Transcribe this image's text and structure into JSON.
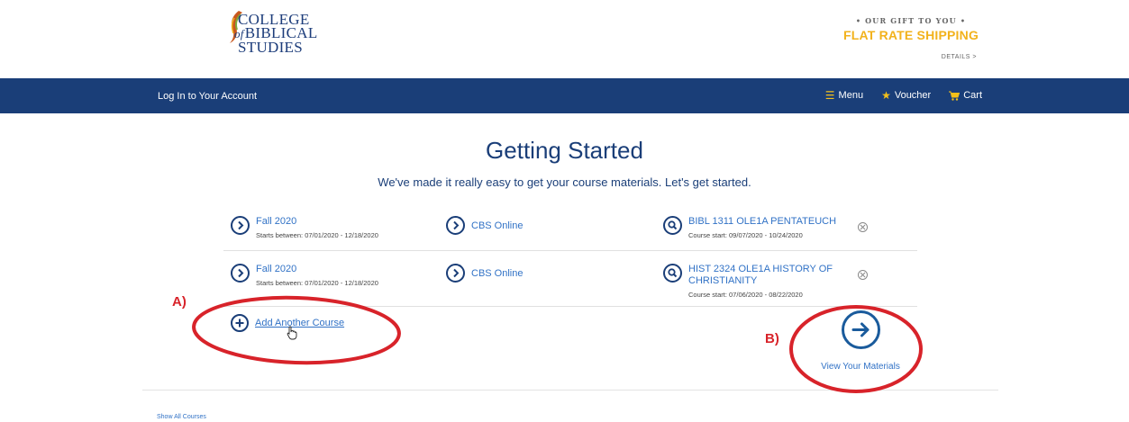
{
  "logo": {
    "line1": "COLLEGE",
    "line2_prefix": "of",
    "line2": "BIBLICAL",
    "line3": "STUDIES"
  },
  "promo": {
    "top": "• OUR GIFT TO YOU •",
    "main": "FLAT RATE SHIPPING",
    "details": "DETAILS >"
  },
  "navbar": {
    "login": "Log In to Your Account",
    "menu": "Menu",
    "voucher": "Voucher",
    "cart": "Cart",
    "color": "#1a3e78"
  },
  "main": {
    "title": "Getting Started",
    "subtitle": "We've made it really easy to get your course materials. Let's get started."
  },
  "courses": [
    {
      "term": "Fall 2020",
      "term_dates": "Starts between: 07/01/2020 - 12/18/2020",
      "school": "CBS Online",
      "course": "BIBL 1311 OLE1A PENTATEUCH",
      "course_dates": "Course start: 09/07/2020 - 10/24/2020"
    },
    {
      "term": "Fall 2020",
      "term_dates": "Starts between: 07/01/2020 - 12/18/2020",
      "school": "CBS Online",
      "course": "HIST 2324 OLE1A HISTORY OF CHRISTIANITY",
      "course_dates": "Course start: 07/06/2020 - 08/22/2020"
    }
  ],
  "actions": {
    "add_course": "Add Another Course",
    "view_materials": "View Your Materials",
    "show_all": "Show All Courses"
  },
  "annotations": {
    "a": "A)",
    "b": "B)",
    "color": "#d8232a"
  },
  "colors": {
    "accent": "#f2b21c",
    "link": "#3172c6",
    "navy": "#1a3e78"
  }
}
